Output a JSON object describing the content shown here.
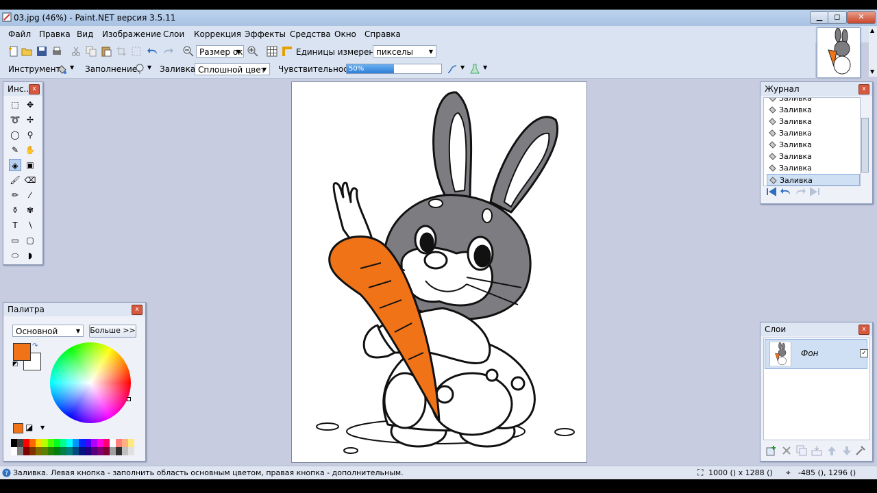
{
  "window": {
    "title": "03.jpg (46%) - Paint.NET версия 3.5.11",
    "minimize_glyph": "▁",
    "maximize_glyph": "◻",
    "close_glyph": "✕"
  },
  "menu": [
    "Файл",
    "Правка",
    "Вид",
    "Изображение",
    "Слои",
    "Коррекция",
    "Эффекты",
    "Средства",
    "Окно",
    "Справка"
  ],
  "toolbar": {
    "zoom_combo": "Размер ок",
    "units_label": "Единицы измерения:",
    "units_value": "пикселы"
  },
  "toolbar2": {
    "tool_label": "Инструмент:",
    "fill_mode_label": "Заполнение:",
    "fill_label": "Заливка:",
    "fill_value": "Сплошной цвет",
    "tolerance_label": "Чувствительность:",
    "tolerance_value": "50%",
    "tolerance_fraction": 0.5
  },
  "tools_panel": {
    "title": "Инс...",
    "close": "x"
  },
  "history_panel": {
    "title": "Журнал",
    "close": "x",
    "items": [
      "Заливка",
      "Заливка",
      "Заливка",
      "Заливка",
      "Заливка",
      "Заливка",
      "Заливка",
      "Заливка"
    ]
  },
  "palette_panel": {
    "title": "Палитра",
    "close": "x",
    "mode": "Основной",
    "more_button": "Больше >>",
    "primary_color": "#f07318",
    "secondary_color": "#ffffff"
  },
  "layers_panel": {
    "title": "Слои",
    "close": "x",
    "layer_name": "Фон",
    "layer_visible": true
  },
  "status": {
    "hint": "Заливка. Левая кнопка - заполнить область основным цветом, правая кнопка - дополнительным.",
    "image_size": "1000 () x 1288 ()",
    "cursor_pos": "-485 (), 1296 ()"
  },
  "colors": {
    "rabbit_gray": "#7d7c80",
    "carrot_orange": "#f07318"
  }
}
